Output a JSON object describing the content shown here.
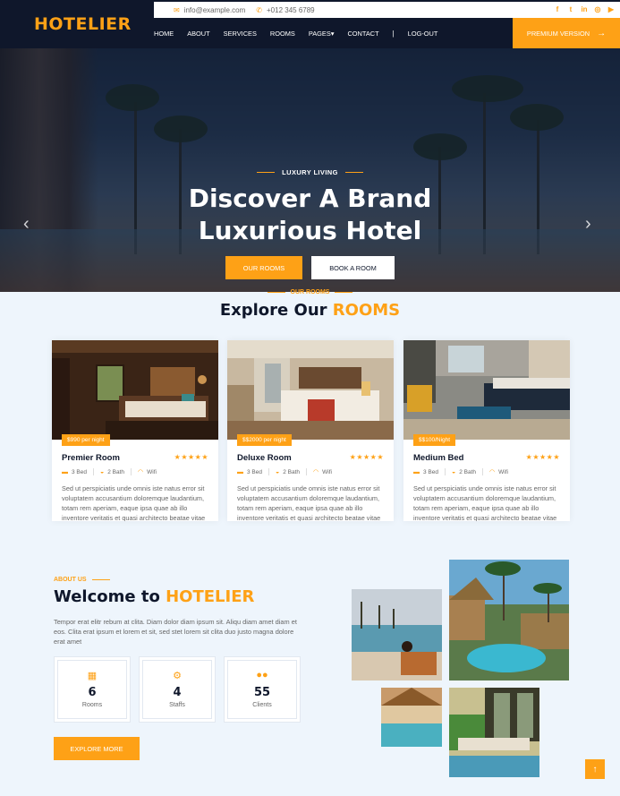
{
  "brand": {
    "name": "HOTELIER"
  },
  "topbar": {
    "email": "info@example.com",
    "phone": "+012 345 6789",
    "email_icon": "envelope-icon",
    "phone_icon": "phone-icon",
    "socials": [
      "facebook-icon",
      "twitter-icon",
      "linkedin-icon",
      "instagram-icon",
      "youtube-icon"
    ]
  },
  "nav": {
    "items": [
      "HOME",
      "ABOUT",
      "SERVICES",
      "ROOMS",
      "PAGES",
      "CONTACT",
      "LOG-OUT"
    ],
    "separator": "|",
    "dropdown_caret": "▾",
    "premium_label": "PREMIUM VERSION",
    "premium_icon": "arrow-right-icon"
  },
  "hero": {
    "eyebrow": "LUXURY LIVING",
    "title_line1": "Discover A Brand",
    "title_line2": "Luxurious Hotel",
    "btn_rooms": "OUR ROOMS",
    "btn_book": "BOOK A ROOM",
    "prev_icon": "chevron-left-icon",
    "next_icon": "chevron-right-icon"
  },
  "rooms": {
    "eyebrow": "OUR ROOMS",
    "title_main": "Explore Our",
    "title_accent": "ROOMS",
    "cards": [
      {
        "price": "$990 per night",
        "name": "Premier Room",
        "rating": 5,
        "bed": "3 Bed",
        "bath": "2 Bath",
        "wifi": "Wifi",
        "desc": "Sed ut perspiciatis unde omnis iste natus error sit voluptatem accusantium doloremque laudantium, totam rem aperiam, eaque ipsa quae ab illo inventore veritatis et quasi architecto beatae vitae"
      },
      {
        "price": "$$2000 per night",
        "name": "Deluxe Room",
        "rating": 5,
        "bed": "3 Bed",
        "bath": "2 Bath",
        "wifi": "Wifi",
        "desc": "Sed ut perspiciatis unde omnis iste natus error sit voluptatem accusantium doloremque laudantium, totam rem aperiam, eaque ipsa quae ab illo inventore veritatis et quasi architecto beatae vitae"
      },
      {
        "price": "$$100/Night",
        "name": "Medium Bed",
        "rating": 5,
        "bed": "3 Bed",
        "bath": "2 Bath",
        "wifi": "Wifi",
        "desc": "Sed ut perspiciatis unde omnis iste natus error sit voluptatem accusantium doloremque laudantium, totam rem aperiam, eaque ipsa quae ab illo inventore veritatis et quasi architecto beatae vitae"
      }
    ],
    "star": "★★★★★"
  },
  "about": {
    "eyebrow": "ABOUT US",
    "title_main": "Welcome to",
    "title_accent": "HOTELIER",
    "text": "Tempor erat elitr rebum at clita. Diam dolor diam ipsum sit. Aliqu diam amet diam et eos. Clita erat ipsum et lorem et sit, sed stet lorem sit clita duo justo magna dolore erat amet",
    "stats": [
      {
        "icon": "hotel-icon",
        "value": "6",
        "label": "Rooms"
      },
      {
        "icon": "users-cog-icon",
        "value": "4",
        "label": "Staffs"
      },
      {
        "icon": "users-icon",
        "value": "55",
        "label": "Clients"
      }
    ],
    "button": "EXPLORE MORE"
  },
  "back_to_top_icon": "arrow-up-icon",
  "colors": {
    "accent": "#fea116",
    "dark": "#0f172b",
    "page_bg": "#eef5fc"
  }
}
